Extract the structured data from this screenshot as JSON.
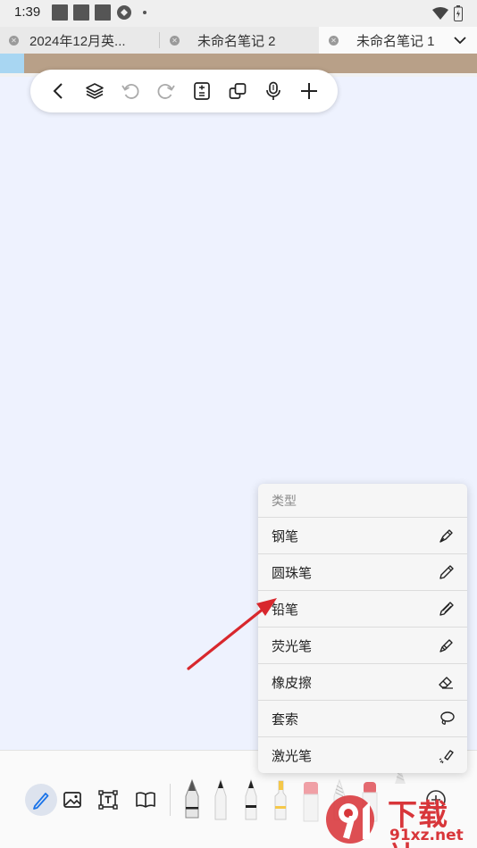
{
  "status_bar": {
    "time": "1:39"
  },
  "tabs": [
    {
      "label": "2024年12月英..."
    },
    {
      "label": "未命名笔记 2"
    },
    {
      "label": "未命名笔记 1"
    }
  ],
  "menu": {
    "header": "类型",
    "items": [
      {
        "label": "钢笔",
        "icon": "fountain-pen-icon"
      },
      {
        "label": "圆珠笔",
        "icon": "ballpoint-pen-icon"
      },
      {
        "label": "铅笔",
        "icon": "pencil-icon"
      },
      {
        "label": "荧光笔",
        "icon": "highlighter-icon"
      },
      {
        "label": "橡皮擦",
        "icon": "eraser-icon"
      },
      {
        "label": "套索",
        "icon": "lasso-icon"
      },
      {
        "label": "激光笔",
        "icon": "laser-pointer-icon"
      }
    ]
  },
  "watermark": {
    "top": "下载站",
    "bottom": "91xz.net"
  },
  "colors": {
    "canvas": "#eef2fe",
    "strip": "#b8a088",
    "strip_start": "#a8d6f2",
    "accent": "#1a73e8",
    "arrow": "#d8272d"
  }
}
